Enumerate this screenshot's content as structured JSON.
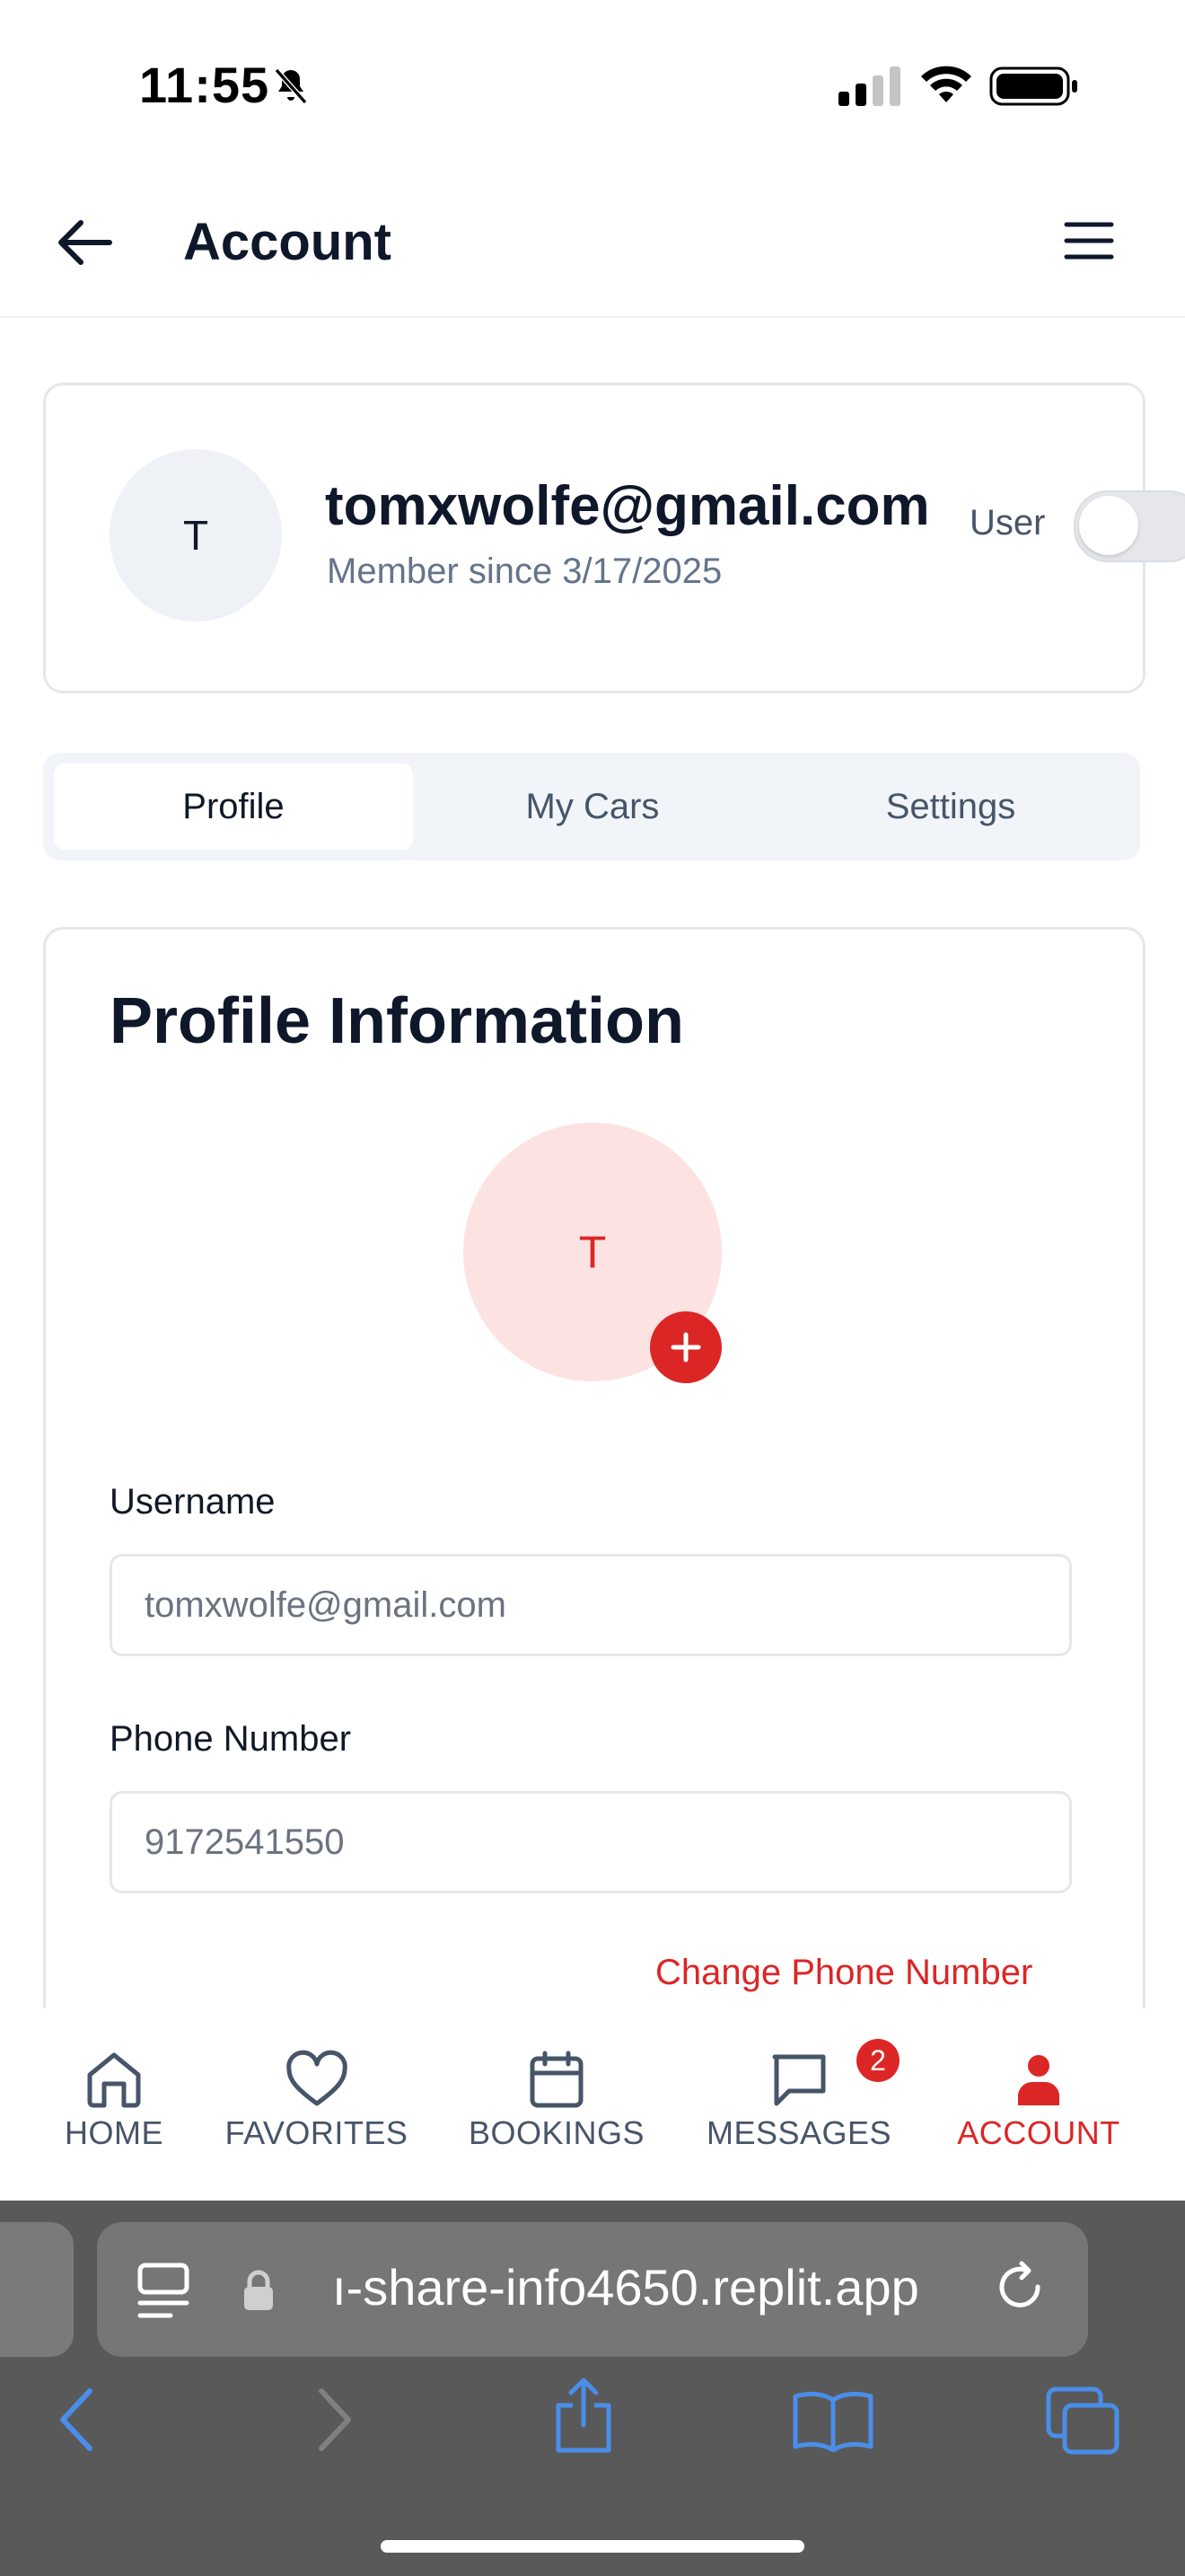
{
  "status_bar": {
    "time": "11:55"
  },
  "header": {
    "title": "Account"
  },
  "user_summary": {
    "avatar_initial": "T",
    "email": "tomxwolfe@gmail.com",
    "member_since": "Member since 3/17/2025",
    "role_label": "User",
    "role_toggle_on": false
  },
  "tabs": [
    {
      "label": "Profile",
      "active": true
    },
    {
      "label": "My Cars",
      "active": false
    },
    {
      "label": "Settings",
      "active": false
    }
  ],
  "profile": {
    "title": "Profile Information",
    "avatar_initial": "T",
    "username_label": "Username",
    "username_value": "tomxwolfe@gmail.com",
    "phone_label": "Phone Number",
    "phone_value": "9172541550",
    "change_phone_link": "Change Phone Number"
  },
  "bottom_nav": [
    {
      "label": "HOME",
      "icon": "home-icon",
      "active": false
    },
    {
      "label": "FAVORITES",
      "icon": "heart-icon",
      "active": false
    },
    {
      "label": "BOOKINGS",
      "icon": "calendar-icon",
      "active": false
    },
    {
      "label": "MESSAGES",
      "icon": "message-icon",
      "active": false,
      "badge": "2"
    },
    {
      "label": "ACCOUNT",
      "icon": "user-icon",
      "active": true
    }
  ],
  "browser": {
    "url": "ı-share-info4650.replit.app"
  },
  "colors": {
    "accent": "#dc2626",
    "text": "#0f172a",
    "muted": "#64748b",
    "browser_bg": "#595959",
    "browser_blue": "#4a8eea"
  }
}
